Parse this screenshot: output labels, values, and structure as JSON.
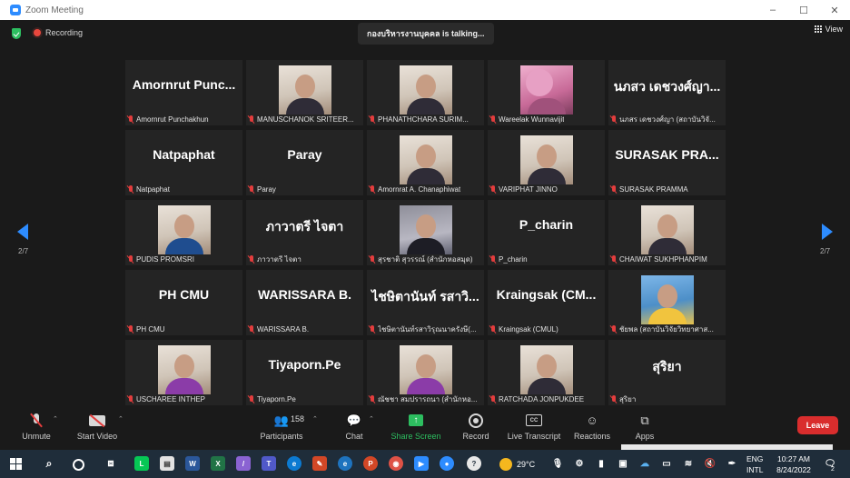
{
  "window": {
    "title": "Zoom Meeting",
    "buttons": [
      "–",
      "☐",
      "✕"
    ]
  },
  "top": {
    "recording_label": "Recording",
    "talking_text": "กองบริหารงานบุคคล is talking...",
    "view_label": "View"
  },
  "pager": {
    "left": "2/7",
    "right": "2/7"
  },
  "tiles": [
    {
      "display": "Amornrut Punc...",
      "name": "Amornrut Punchakhun",
      "photo": ""
    },
    {
      "display": "",
      "name": "MANUSCHANOK SRITEER...",
      "photo": "woman"
    },
    {
      "display": "",
      "name": "PHANATHCHARA SURIM...",
      "photo": "woman"
    },
    {
      "display": "",
      "name": "Wareelak Wunnavijit",
      "photo": "blossom"
    },
    {
      "display": "นภสว เดชวงศ์ญา...",
      "name": "นภสร เดชวงศ์ญา (สถาบันวิจั...",
      "photo": ""
    },
    {
      "display": "Natpaphat",
      "name": "Natpaphat",
      "photo": ""
    },
    {
      "display": "Paray",
      "name": "Paray",
      "photo": ""
    },
    {
      "display": "",
      "name": "Amornrat A. Chanaphiwat",
      "photo": "woman"
    },
    {
      "display": "",
      "name": "VARIPHAT JINNO",
      "photo": "woman"
    },
    {
      "display": "SURASAK PRA...",
      "name": "SURASAK PRAMMA",
      "photo": ""
    },
    {
      "display": "",
      "name": "PUDIS PROMSRI",
      "photo": "blue"
    },
    {
      "display": "ภาวาตรี ไจตา",
      "name": "ภาวาตรี ไจตา",
      "photo": ""
    },
    {
      "display": "",
      "name": "สุรชาติ สุวรรณ์ (สำนักหอสมุด)",
      "photo": "room"
    },
    {
      "display": "P_charin",
      "name": "P_charin",
      "photo": ""
    },
    {
      "display": "",
      "name": "CHAIWAT SUKHPHANPIM",
      "photo": "woman"
    },
    {
      "display": "PH CMU",
      "name": "PH CMU",
      "photo": ""
    },
    {
      "display": "WARISSARA B.",
      "name": "WARISSARA B.",
      "photo": ""
    },
    {
      "display": "ไชษิตานันท์ รสาวิ...",
      "name": "ไชษิตานันท์รสาวิรุณนาครังษี(...",
      "photo": ""
    },
    {
      "display": "Kraingsak (CM...",
      "name": "Kraingsak (CMUL)",
      "photo": ""
    },
    {
      "display": "",
      "name": "ชัยพล (สถาบันวิจัยวิทยาศาส...",
      "photo": "outdoor"
    },
    {
      "display": "",
      "name": "USCHAREE INTHEP",
      "photo": "purple"
    },
    {
      "display": "Tiyaporn.Pe",
      "name": "Tiyaporn.Pe",
      "photo": ""
    },
    {
      "display": "",
      "name": "ณัชชา สมปรารถนา (สำนักหอ...",
      "photo": "purple"
    },
    {
      "display": "",
      "name": "RATCHADA JONPUKDEE",
      "photo": "woman"
    },
    {
      "display": "สุริยา",
      "name": "สุริยา",
      "photo": ""
    }
  ],
  "toolbar": {
    "unmute": "Unmute",
    "start_video": "Start Video",
    "participants": "Participants",
    "participants_count": "158",
    "chat": "Chat",
    "share_screen": "Share Screen",
    "record": "Record",
    "live_transcript": "Live Transcript",
    "reactions": "Reactions",
    "apps": "Apps",
    "leave": "Leave",
    "cc_text": "CC"
  },
  "taskbar": {
    "weather": "29°C",
    "lang_top": "ENG",
    "lang_bottom": "INTL",
    "time": "10:27 AM",
    "date": "8/24/2022",
    "notification_count": "2"
  },
  "colors": {
    "accent": "#2d8cff",
    "share": "#2dbe60",
    "leave": "#d92d2d",
    "muted": "#e33d3d"
  }
}
